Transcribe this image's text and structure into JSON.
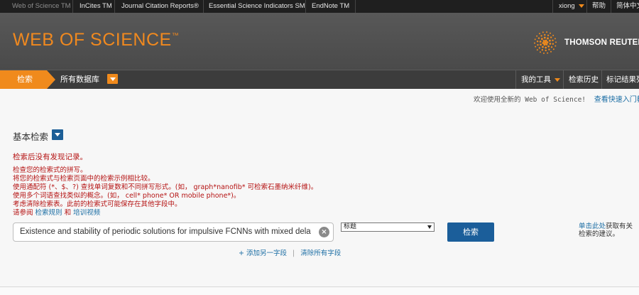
{
  "topbar": {
    "products": [
      "Web of Science TM",
      "InCites TM",
      "Journal Citation Reports®",
      "Essential Science Indicators SM",
      "EndNote TM"
    ],
    "user": "xiong",
    "help": "帮助",
    "language": "简体中文"
  },
  "header": {
    "logo": "WEB OF SCIENCE",
    "logo_tm": "™",
    "brand": "THOMSON REUTERS"
  },
  "nav": {
    "search_tab": "检索",
    "database": "所有数据库",
    "my_tools": "我的工具",
    "history": "检索历史",
    "marked": "标记结果列"
  },
  "welcome": {
    "text": "欢迎使用全新的 Web of Science!",
    "link": "查看快速入门教"
  },
  "search": {
    "mode": "基本检索",
    "no_results": "检索后没有发现记录。",
    "suggestions": [
      "检查您的检索式的拼写。",
      "将您的检索式与检索页面中的检索示例相比较。",
      "使用通配符 (*、$、?) 查找单词复数和不同拼写形式。(如， graph*nanofib* 可检索石墨纳米纤维)。",
      "使用多个词语查找类似的概念。(如， cell* phone* OR mobile phone*)。",
      "考虑清除检索表。此前的检索式可能保存在其他字段中。"
    ],
    "help_prefix": "请参阅",
    "help_rules": "检索规则",
    "help_and": "和",
    "help_video": "培训视频",
    "query_value": "Existence and stability of periodic solutions for impulsive FCNNs with mixed delays",
    "field_value": "标题",
    "search_button": "检索",
    "add_field": "+ 添加另一字段",
    "clear_all": "清除所有字段",
    "tip_link": "单击此处",
    "tip_text_1": "获取有关",
    "tip_text_2": "检索的建议。"
  },
  "colors": {
    "accent_orange": "#f08a1c",
    "button_blue": "#1b5e9a",
    "error_red": "#b51313",
    "link_blue": "#1c6ea4"
  }
}
